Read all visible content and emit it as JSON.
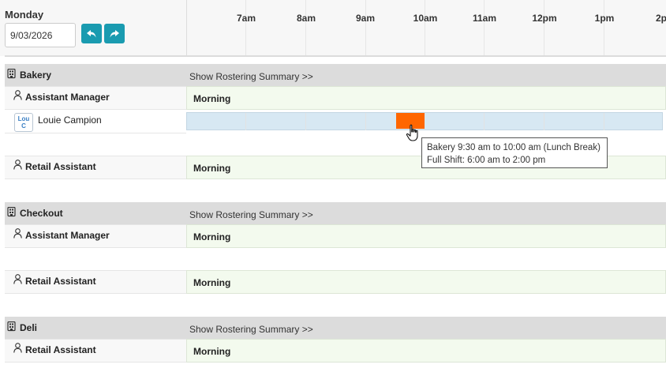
{
  "header": {
    "day": "Monday",
    "date_value": "9/03/2026",
    "prev_icon": "undo-arrow-icon",
    "next_icon": "redo-arrow-icon",
    "hours": [
      "7am",
      "8am",
      "9am",
      "10am",
      "11am",
      "12pm",
      "1pm",
      "2p"
    ]
  },
  "colors": {
    "accent": "#1a9bb0",
    "break": "#ff6600",
    "shift_bg": "#f3faee",
    "person_bar": "#d7e8f3",
    "dept_bg": "#dcdcdc"
  },
  "departments": [
    {
      "name": "Bakery",
      "summary_link": "Show Rostering Summary >>",
      "roles": [
        {
          "name": "Assistant Manager",
          "shift": "Morning",
          "staff": [
            {
              "initials_1": "Lou",
              "initials_2": "C",
              "name": "Louie Campion"
            }
          ]
        },
        {
          "name": "Retail Assistant",
          "shift": "Morning"
        }
      ]
    },
    {
      "name": "Checkout",
      "summary_link": "Show Rostering Summary >>",
      "roles": [
        {
          "name": "Assistant Manager",
          "shift": "Morning"
        },
        {
          "name": "Retail Assistant",
          "shift": "Morning"
        }
      ]
    },
    {
      "name": "Deli",
      "summary_link": "Show Rostering Summary >>",
      "roles": [
        {
          "name": "Retail Assistant",
          "shift": "Morning"
        }
      ]
    }
  ],
  "tooltip": {
    "line1": "Bakery 9:30 am to 10:00 am (Lunch Break)",
    "line2": "Full Shift: 6:00 am to 2:00 pm"
  },
  "icons": {
    "department": "building-icon",
    "role": "user-outline-icon",
    "cursor": "hand-pointer-icon"
  }
}
